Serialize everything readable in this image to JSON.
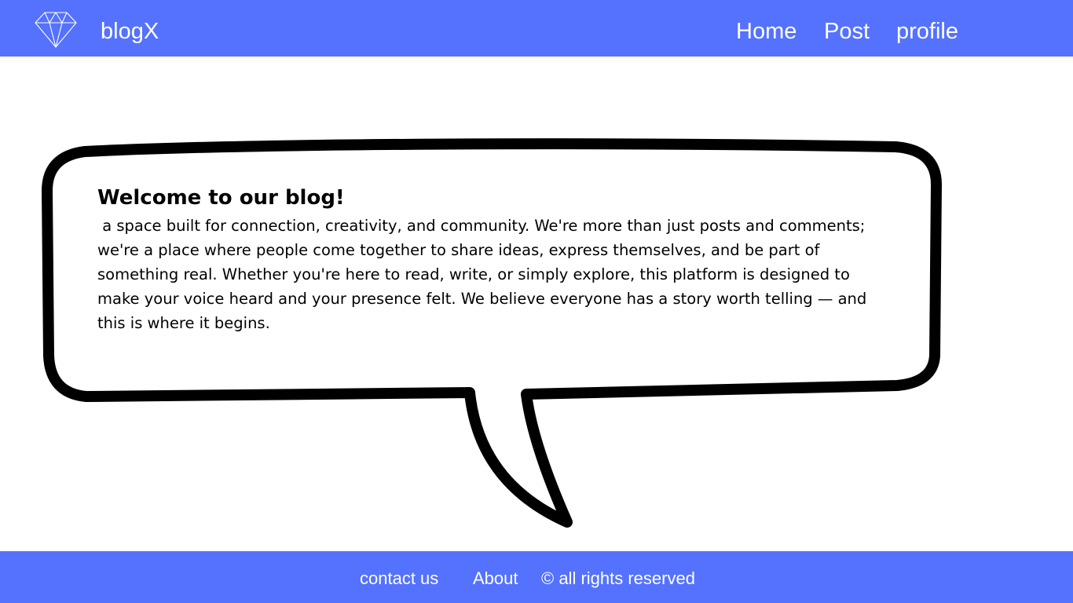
{
  "header": {
    "brand": "blogX",
    "nav": [
      {
        "label": "Home"
      },
      {
        "label": "Post"
      },
      {
        "label": "profile"
      }
    ],
    "logo_icon": "diamond-icon",
    "background_color": "#5472fe"
  },
  "main": {
    "title": "Welcome to our blog!",
    "body": " a space built for connection, creativity, and community. We're more than just posts and comments; we're a place where people come together to share ideas, express themselves, and be part of something real. Whether you're here to read, write, or simply explore, this platform is designed to make your voice heard and your presence felt. We believe everyone has a story worth telling — and this is where it begins."
  },
  "footer": {
    "contact": "contact us",
    "about": "About",
    "rights": "© all rights reserved",
    "background_color": "#5472fe"
  }
}
